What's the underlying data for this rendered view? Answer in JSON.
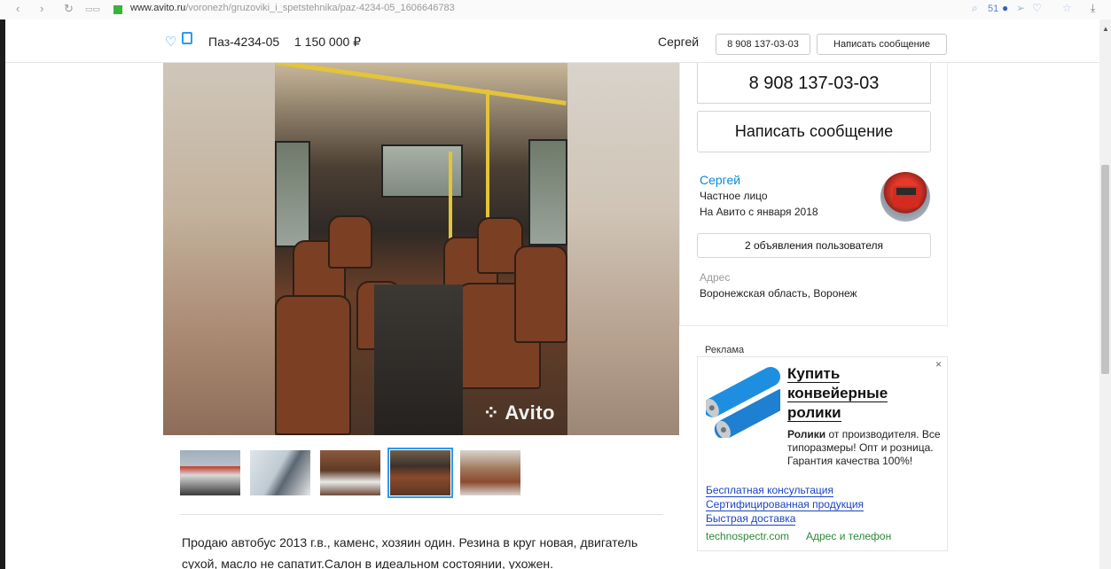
{
  "browser": {
    "url_host": "www.avito.ru",
    "url_path": "/voronezh/gruzoviki_i_spetstehnika/paz-4234-05_1606646783",
    "nav_back": "‹",
    "nav_forward": "›",
    "reload": "↻",
    "tabs_icon": "▭▭",
    "ext_count": "51"
  },
  "sticky": {
    "title": "Паз-4234-05",
    "price": "1 150 000 ₽",
    "seller": "Сергей",
    "phone_button": "8 908 137-03-03",
    "message_button": "Написать сообщение"
  },
  "contact": {
    "phone": "8 908 137-03-03",
    "message_button": "Написать сообщение",
    "seller_name": "Сергей",
    "seller_type": "Частное лицо",
    "seller_since": "На Авито с января 2018",
    "ads_button": "2 объявления пользователя",
    "address_label": "Адрес",
    "address_value": "Воронежская область, Воронеж"
  },
  "gallery": {
    "watermark": "Avito",
    "thumbnails": [
      {
        "selected": false
      },
      {
        "selected": false
      },
      {
        "selected": false
      },
      {
        "selected": true
      },
      {
        "selected": false
      }
    ]
  },
  "description": {
    "line1": "Продаю автобус 2013 г.в., каменс, хозяин один. Резина в круг новая, двигатель",
    "line2": "сухой, масло не сапатит.Салон в идеальном состоянии, ухожен."
  },
  "ad": {
    "label": "Реклама",
    "close": "×",
    "headline": [
      "Купить",
      "конвейерные",
      "ролики"
    ],
    "text_bold": "Ролики",
    "text_rest": " от производителя. Все типоразмеры! Опт и розница. Гарантия качества 100%!",
    "links": [
      "Бесплатная консультация",
      "Сертифицированная продукция",
      "Быстрая доставка"
    ],
    "site": "technospectr.com",
    "contacts": "Адрес и телефон"
  },
  "colors": {
    "accent": "#2a9af3",
    "link": "#0a8ad6",
    "ad_link": "#1a44c2",
    "ad_green": "#2a8a36"
  },
  "icons": [
    "heart-icon",
    "note-icon",
    "close-icon",
    "avito-logo"
  ]
}
